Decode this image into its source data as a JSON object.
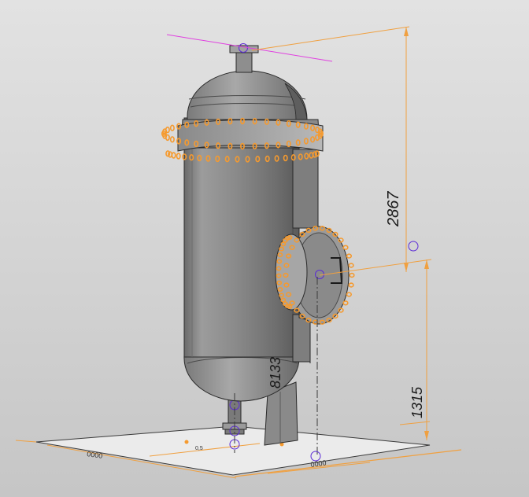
{
  "viewport": {
    "background_top": "#e2e2e2",
    "background_bottom": "#c6c6c6"
  },
  "colors": {
    "vessel_body": "#8e8e8e",
    "vessel_dark": "#5a5a5a",
    "vessel_light": "#bdbdbd",
    "highlight_orange": "#f59a2f",
    "dimension_orange": "#f0a040",
    "construction_purple": "#5b2bd6",
    "construction_magenta": "#e040e0",
    "outline": "#2a2a2a",
    "base_plate": "#e9e9e9"
  },
  "dimensions": {
    "overall_height": "2867",
    "nozzle_height": "1315",
    "side_label": "8133"
  },
  "base_plate_labels": {
    "front_edge": "0000",
    "left_edge": "0000",
    "small_mark": "0,5"
  },
  "icons": {
    "point_marker": "circle-marker-icon",
    "bolt": "bolt-hole-icon"
  }
}
